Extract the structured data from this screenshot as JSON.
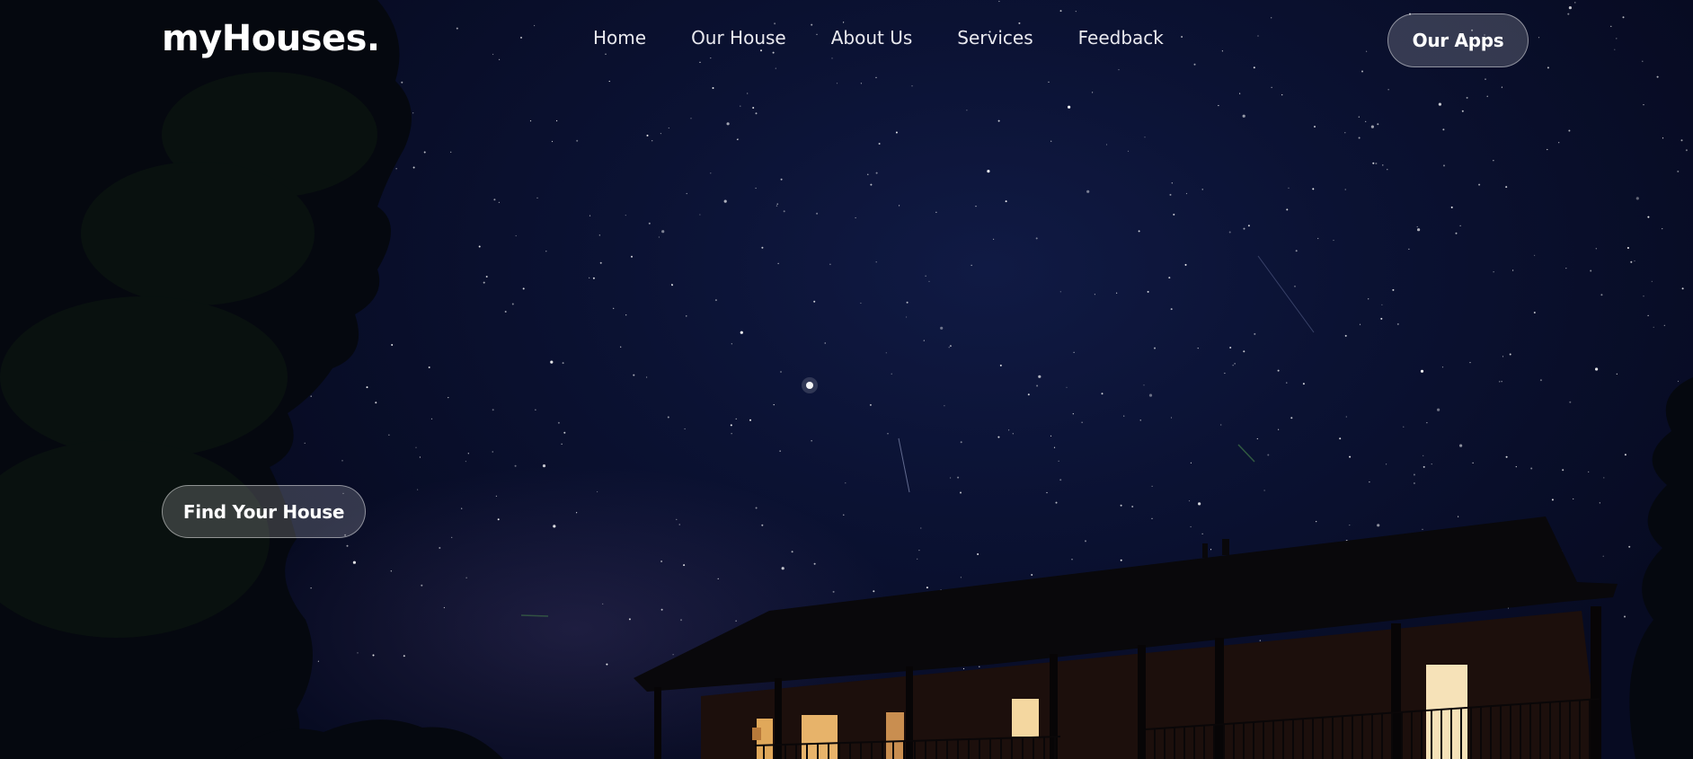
{
  "brand": {
    "logo_text": "myHouses."
  },
  "nav": {
    "items": [
      {
        "label": "Home"
      },
      {
        "label": "Our House"
      },
      {
        "label": "About Us"
      },
      {
        "label": "Services"
      },
      {
        "label": "Feedback"
      }
    ]
  },
  "header": {
    "apps_button_label": "Our Apps"
  },
  "hero": {
    "cta_label": "Find Your House"
  },
  "colors": {
    "sky": "#0b1233",
    "text": "#ffffff",
    "window_light": "#f0c070"
  }
}
